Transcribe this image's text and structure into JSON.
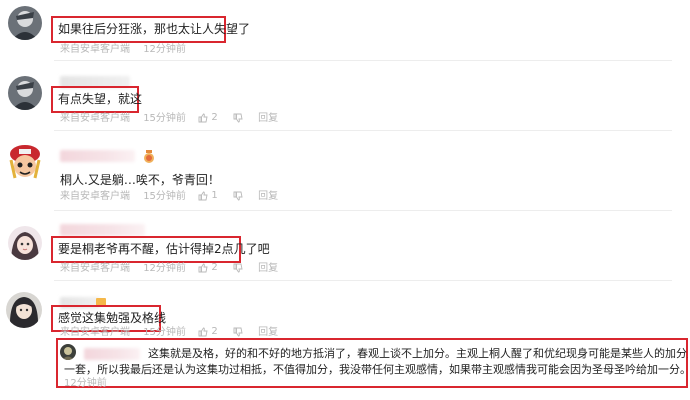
{
  "comments": [
    {
      "text": "如果往后分狂涨，那也太让人失望了",
      "source": "来自安卓客户端",
      "time": "12分钟前",
      "likes": "",
      "reply": ""
    },
    {
      "text": "有点失望，就这",
      "source": "来自安卓客户端",
      "time": "15分钟前",
      "likes": "2",
      "reply": "回复"
    },
    {
      "text": "桐人.又是躺…唉不，爷青回！",
      "source": "来自安卓客户端",
      "time": "15分钟前",
      "likes": "1",
      "reply": "回复"
    },
    {
      "text": "要是桐老爷再不醒，估计得掉2点几了吧",
      "source": "来自安卓客户端",
      "time": "12分钟前",
      "likes": "2",
      "reply": "回复"
    },
    {
      "text": "感觉这集勉强及格线",
      "source": "来自安卓客户端",
      "time": "15分钟前",
      "likes": "2",
      "reply": "回复"
    }
  ],
  "nested_reply": {
    "line1": "这集就是及格，好的和不好的地方抵消了，春观上谈不上加分。主观上桐人醒了和优纪现身可能是某些人的加分点，但我自己不吃这",
    "line2": "一套，所以我最后还是认为这集功过相抵，不值得加分，我没带任何主观感情，如果带主观感情我可能会因为圣母圣吟给加一分。",
    "time": "12分钟前"
  }
}
